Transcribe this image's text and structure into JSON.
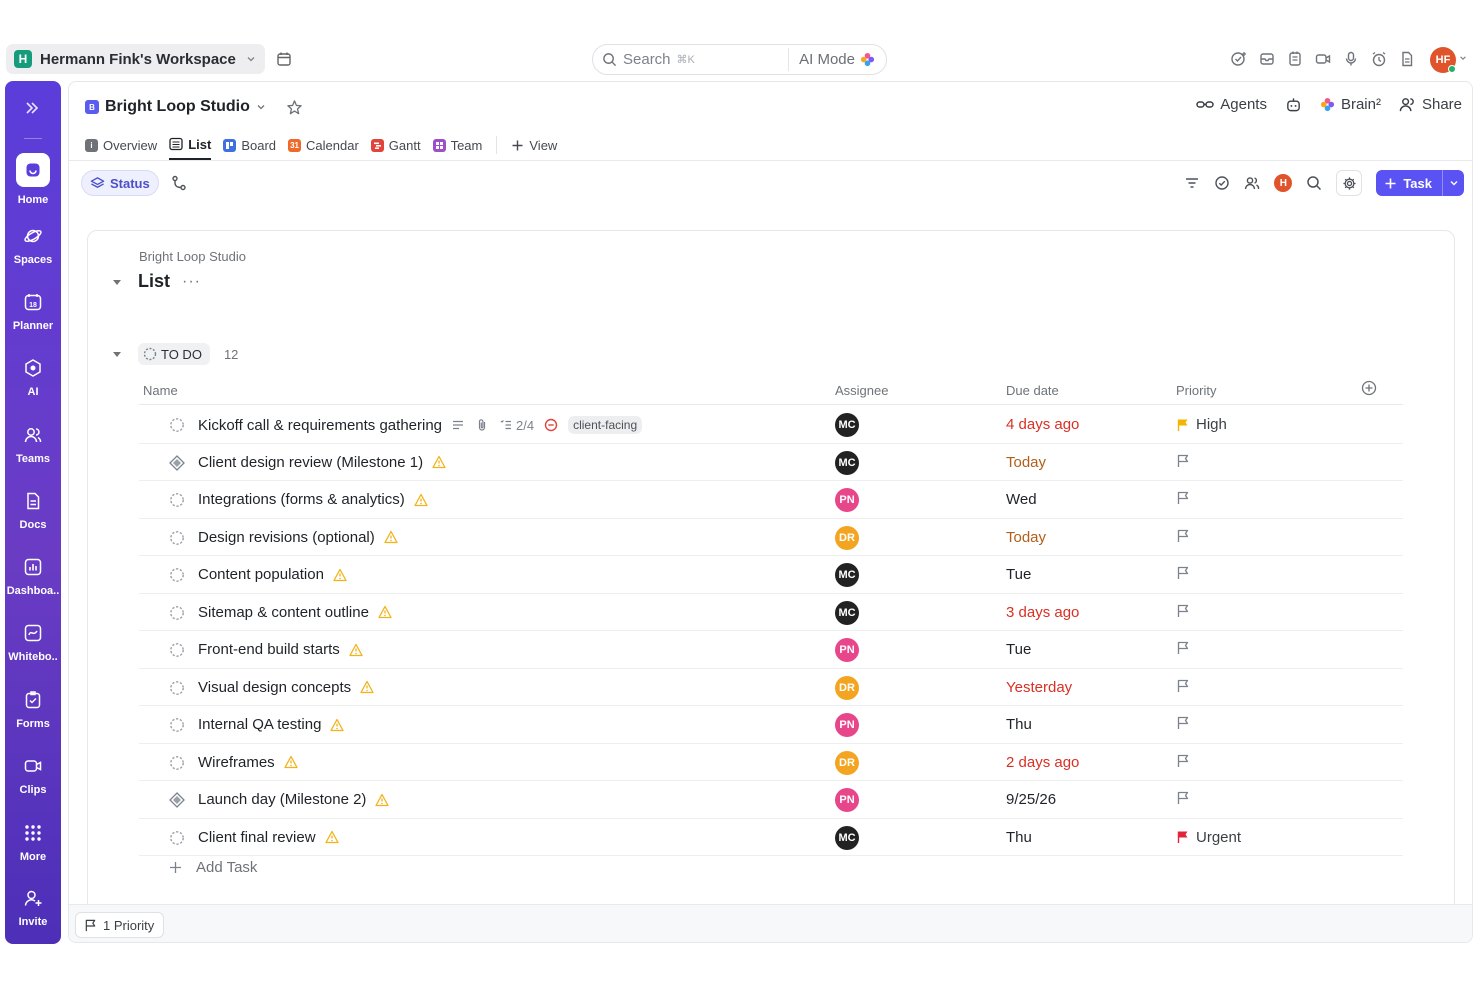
{
  "workspace": {
    "logo": "H",
    "name": "Hermann Fink's Workspace"
  },
  "search": {
    "placeholder": "Search",
    "shortcut": "⌘K",
    "ai_mode": "AI Mode"
  },
  "user": {
    "initials": "HF"
  },
  "sidebar": {
    "items": [
      {
        "label": "Home",
        "icon": "home-icon"
      },
      {
        "label": "Spaces",
        "icon": "planet-icon"
      },
      {
        "label": "Planner",
        "icon": "calendar-icon"
      },
      {
        "label": "AI",
        "icon": "ai-icon"
      },
      {
        "label": "Teams",
        "icon": "teams-icon"
      },
      {
        "label": "Docs",
        "icon": "doc-icon"
      },
      {
        "label": "Dashboa..",
        "icon": "dashboard-icon"
      },
      {
        "label": "Whitebo..",
        "icon": "whiteboard-icon"
      },
      {
        "label": "Forms",
        "icon": "form-icon"
      },
      {
        "label": "Clips",
        "icon": "video-icon"
      },
      {
        "label": "More",
        "icon": "grid-icon"
      },
      {
        "label": "Invite",
        "icon": "add-user-icon"
      }
    ]
  },
  "project": {
    "badge": "B",
    "name": "Bright Loop Studio"
  },
  "header_actions": {
    "agents": "Agents",
    "brain": "Brain²",
    "share": "Share"
  },
  "tabs": [
    {
      "label": "Overview",
      "color": "#6f7378"
    },
    {
      "label": "List",
      "color": "#ffffff",
      "active": true
    },
    {
      "label": "Board",
      "color": "#3f6fe0"
    },
    {
      "label": "Calendar",
      "color": "#ee6a2a"
    },
    {
      "label": "Gantt",
      "color": "#e0443a"
    },
    {
      "label": "Team",
      "color": "#9b4fc8"
    }
  ],
  "view_button": "View",
  "toolbar": {
    "status_label": "Status",
    "user_initial": "H",
    "task_button": "Task"
  },
  "list": {
    "breadcrumb": "Bright Loop Studio",
    "title": "List",
    "more": "···",
    "group": {
      "label": "TO DO",
      "count": "12"
    },
    "columns": {
      "name": "Name",
      "assignee": "Assignee",
      "due": "Due date",
      "priority": "Priority"
    },
    "assignee_colors": {
      "MC": "#222222",
      "PN": "#e8468a",
      "DR": "#f3a521"
    },
    "tasks": [
      {
        "name": "Kickoff call & requirements gathering",
        "status": "circle",
        "subtasks": "2/4",
        "tag": "client-facing",
        "extra_meta": true,
        "assignee": "MC",
        "due": "4 days ago",
        "due_color": "#d93025",
        "priority": "High",
        "priority_color": "#f5b400"
      },
      {
        "name": "Client design review (Milestone 1)",
        "status": "milestone",
        "assignee": "MC",
        "due": "Today",
        "due_color": "#b0601c",
        "priority": "",
        "priority_color": "#7c828d"
      },
      {
        "name": "Integrations (forms & analytics)",
        "status": "circle",
        "assignee": "PN",
        "due": "Wed",
        "due_color": "#1f2328",
        "priority": "",
        "priority_color": "#7c828d"
      },
      {
        "name": "Design revisions (optional)",
        "status": "circle",
        "assignee": "DR",
        "due": "Today",
        "due_color": "#b0601c",
        "priority": "",
        "priority_color": "#7c828d"
      },
      {
        "name": "Content population",
        "status": "circle",
        "assignee": "MC",
        "due": "Tue",
        "due_color": "#1f2328",
        "priority": "",
        "priority_color": "#7c828d"
      },
      {
        "name": "Sitemap & content outline",
        "status": "circle",
        "assignee": "MC",
        "due": "3 days ago",
        "due_color": "#d93025",
        "priority": "",
        "priority_color": "#7c828d"
      },
      {
        "name": "Front-end build starts",
        "status": "circle",
        "assignee": "PN",
        "due": "Tue",
        "due_color": "#1f2328",
        "priority": "",
        "priority_color": "#7c828d"
      },
      {
        "name": "Visual design concepts",
        "status": "circle",
        "assignee": "DR",
        "due": "Yesterday",
        "due_color": "#d93025",
        "priority": "",
        "priority_color": "#7c828d"
      },
      {
        "name": "Internal QA testing",
        "status": "circle",
        "assignee": "PN",
        "due": "Thu",
        "due_color": "#1f2328",
        "priority": "",
        "priority_color": "#7c828d"
      },
      {
        "name": "Wireframes",
        "status": "circle",
        "assignee": "DR",
        "due": "2 days ago",
        "due_color": "#d93025",
        "priority": "",
        "priority_color": "#7c828d"
      },
      {
        "name": "Launch day (Milestone 2)",
        "status": "milestone",
        "assignee": "PN",
        "due": "9/25/26",
        "due_color": "#1f2328",
        "priority": "",
        "priority_color": "#7c828d"
      },
      {
        "name": "Client final review",
        "status": "circle",
        "assignee": "MC",
        "due": "Thu",
        "due_color": "#1f2328",
        "priority": "Urgent",
        "priority_color": "#e0243a"
      }
    ],
    "add_task": "Add Task"
  },
  "footer": {
    "chip": "1 Priority"
  }
}
